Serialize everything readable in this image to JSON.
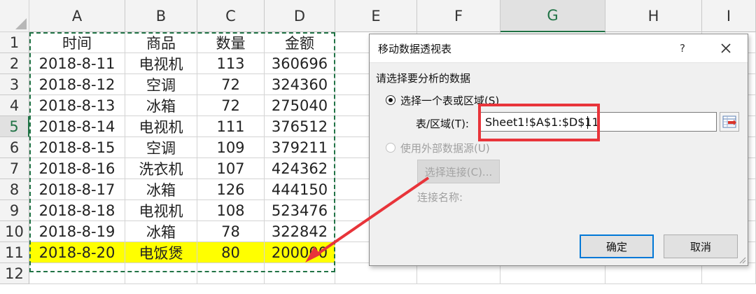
{
  "spreadsheet": {
    "columns": [
      "A",
      "B",
      "C",
      "D",
      "E",
      "F",
      "G",
      "H",
      "I"
    ],
    "selected_column": "G",
    "selected_row": "5",
    "rows": [
      "1",
      "2",
      "3",
      "4",
      "5",
      "6",
      "7",
      "8",
      "9",
      "10",
      "11",
      "12"
    ],
    "table": [
      [
        "时间",
        "商品",
        "数量",
        "金额"
      ],
      [
        "2018-8-11",
        "电视机",
        "113",
        "360696"
      ],
      [
        "2018-8-12",
        "空调",
        "72",
        "324360"
      ],
      [
        "2018-8-13",
        "冰箱",
        "72",
        "275040"
      ],
      [
        "2018-8-14",
        "电视机",
        "111",
        "376512"
      ],
      [
        "2018-8-15",
        "空调",
        "109",
        "379211"
      ],
      [
        "2018-8-16",
        "洗衣机",
        "107",
        "424362"
      ],
      [
        "2018-8-17",
        "冰箱",
        "126",
        "444150"
      ],
      [
        "2018-8-18",
        "电视机",
        "108",
        "523476"
      ],
      [
        "2018-8-19",
        "冰箱",
        "78",
        "322842"
      ],
      [
        "2018-8-20",
        "电饭煲",
        "80",
        "200000"
      ]
    ],
    "highlighted_row": "11",
    "highlight_color": "#ffff00"
  },
  "dialog": {
    "title": "移动数据透视表",
    "help_label": "?",
    "close_icon": "close-icon",
    "prompt": "请选择要分析的数据",
    "option_table": "选择一个表或区域(S)",
    "range_label": "表/区域(T):",
    "range_value": "Sheet1!$A$1:$D$11",
    "option_external": "使用外部数据源(U)",
    "choose_connection_label": "选择连接(C)...",
    "connection_name_label": "连接名称:",
    "ok_label": "确定",
    "cancel_label": "取消"
  },
  "annotation": {
    "color": "#e8343a"
  }
}
